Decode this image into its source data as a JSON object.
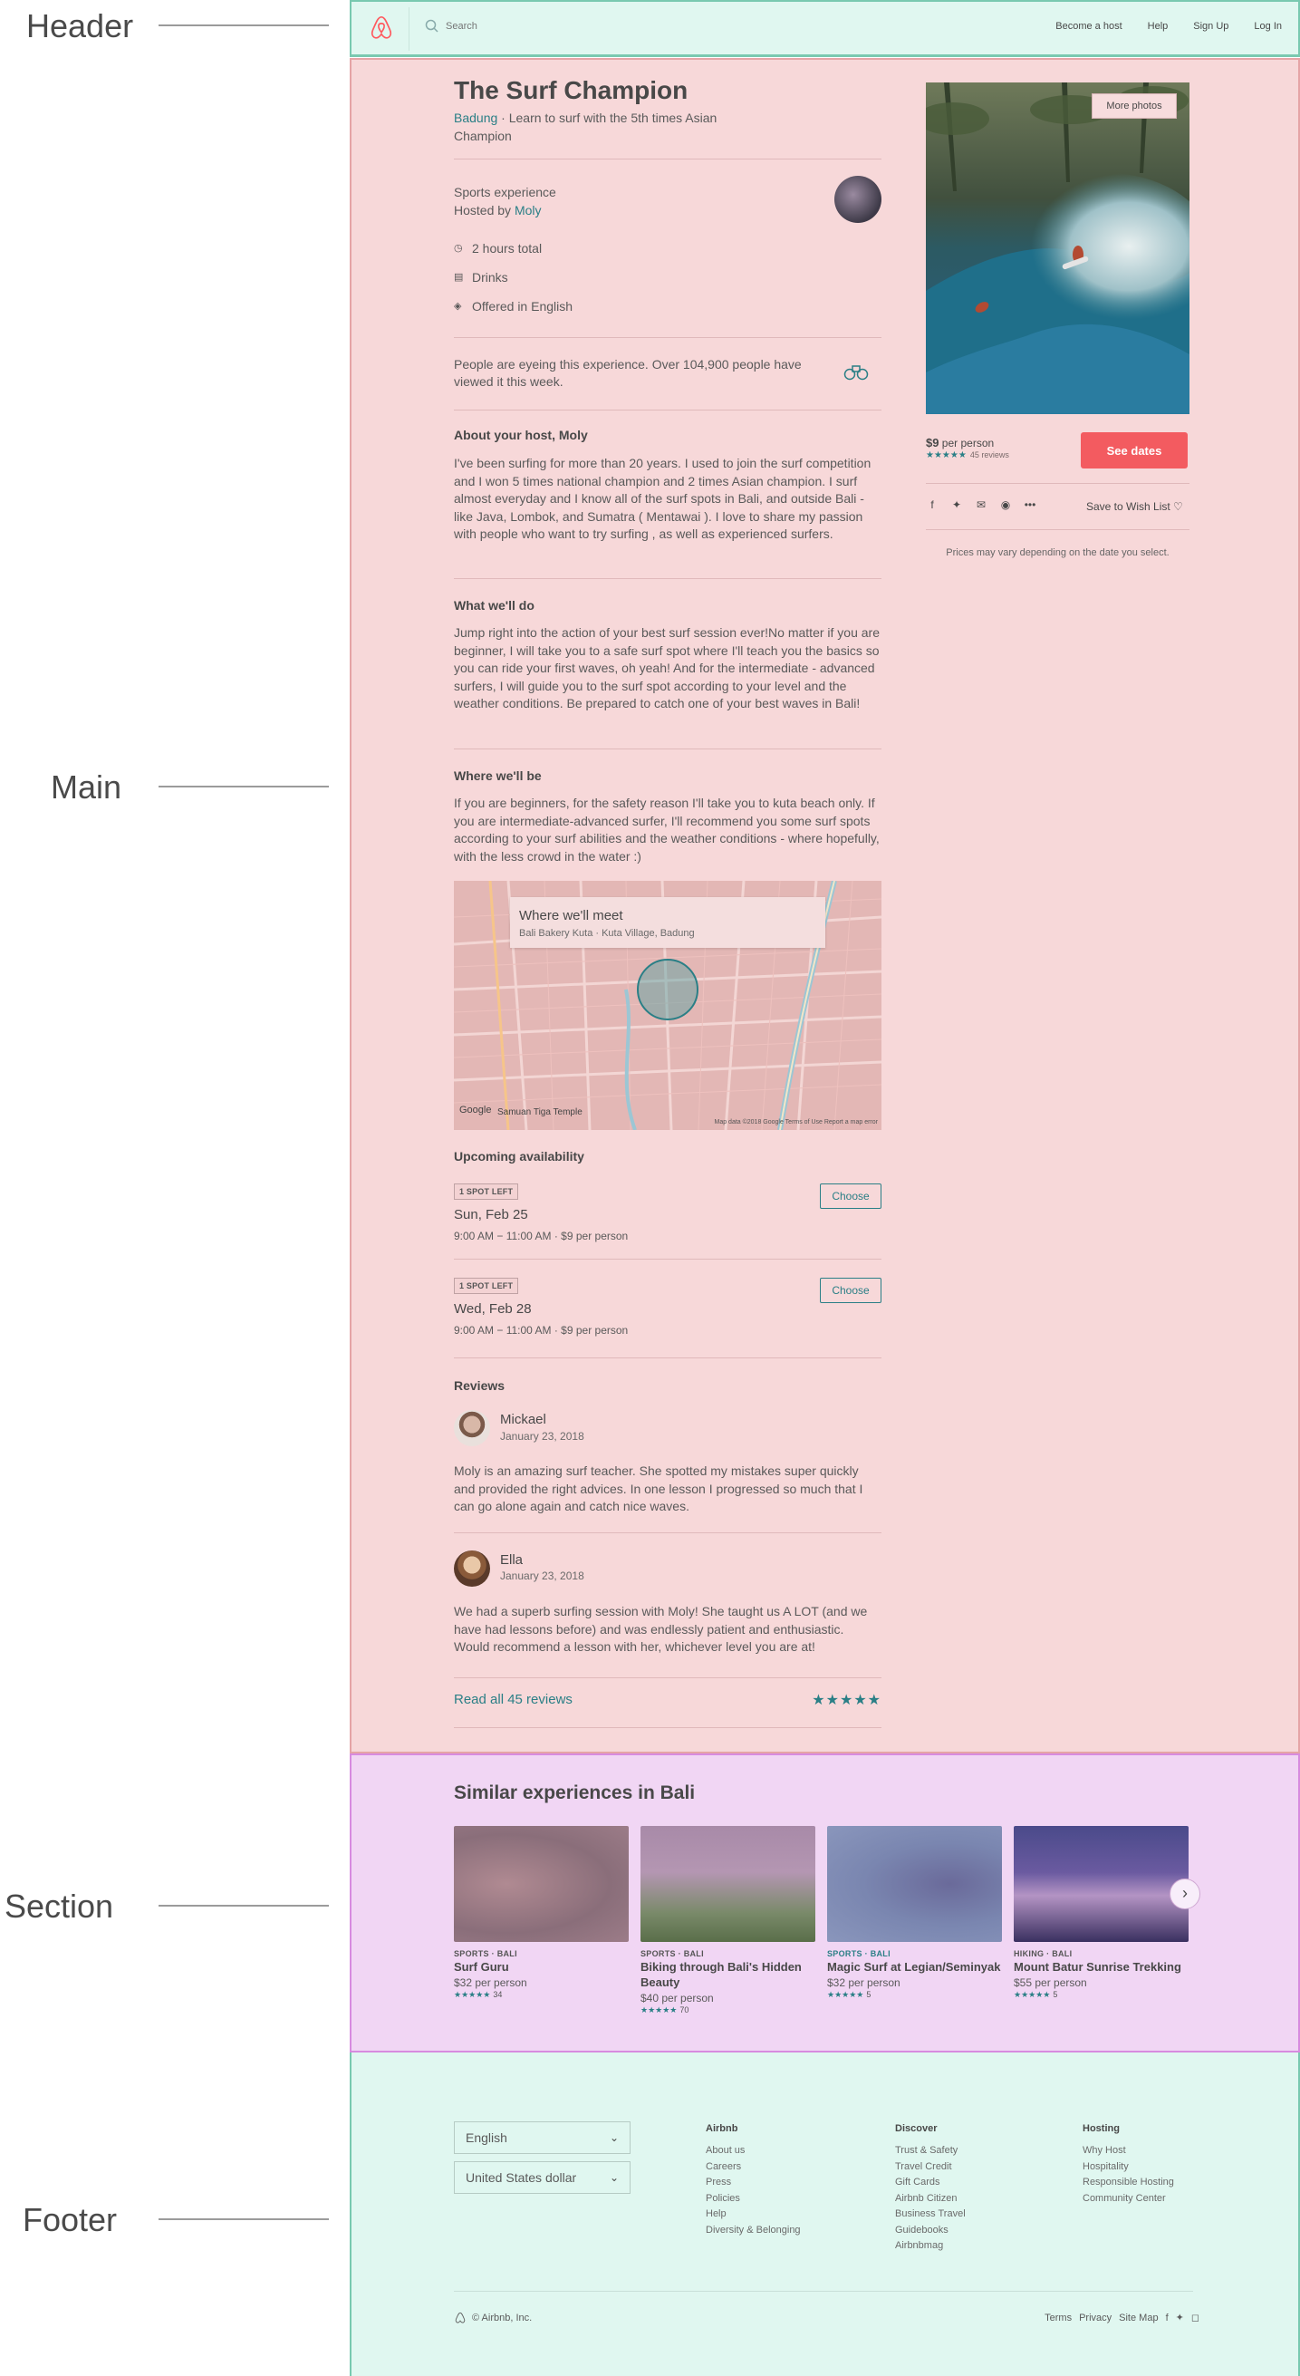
{
  "annotations": {
    "header": "Header",
    "main": "Main",
    "section": "Section",
    "footer": "Footer"
  },
  "header": {
    "search_placeholder": "Search",
    "nav": [
      "Become a host",
      "Help",
      "Sign Up",
      "Log In"
    ]
  },
  "experience": {
    "title": "The Surf Champion",
    "location": "Badung",
    "tagline": " · Learn to surf with the 5th times Asian Champion",
    "type": "Sports experience",
    "hosted_by_prefix": "Hosted by ",
    "host_name": "Moly",
    "features": [
      {
        "icon": "clock-icon",
        "glyph": "◷",
        "label": "2 hours total"
      },
      {
        "icon": "drinks-icon",
        "glyph": "▤",
        "label": "Drinks"
      },
      {
        "icon": "language-icon",
        "glyph": "◈",
        "label": "Offered in English"
      }
    ],
    "eyeing_text": "People are eyeing this experience. Over 104,900 people have viewed it this week.",
    "about_heading": "About your host, Moly",
    "about_text": "I've been surfing for more than 20 years. I used to join the surf competition and I won 5 times national champion and 2 times Asian champion. I surf almost everyday and I know all of the surf spots in Bali, and outside Bali - like Java, Lombok, and Sumatra ( Mentawai ). I love to share my passion with people who want to try surfing , as well as experienced surfers.",
    "what_heading": "What we'll do",
    "what_text": "Jump right into the action of your best surf session ever!No matter if you are beginner, I will take you to a safe surf spot where I'll teach you the basics so you can ride your first waves, oh yeah! And for the intermediate - advanced surfers, I will guide you to the surf spot according to your level and the weather conditions. Be prepared to catch one of your best waves in Bali!",
    "where_heading": "Where we'll be",
    "where_text": "If you are beginners, for the safety reason I'll take you to kuta beach only. If you are intermediate-advanced surfer, I'll recommend you some surf spots according to your surf abilities and the weather conditions - where hopefully, with the less crowd in the water :)"
  },
  "map": {
    "card_title": "Where we'll meet",
    "card_subtitle": "Bali Bakery Kuta · Kuta Village, Badung",
    "poi": "Samuan Tiga Temple",
    "google": "Google",
    "footer": "Map data ©2018 Google   Terms of Use   Report a map error"
  },
  "availability": {
    "heading": "Upcoming availability",
    "slots": [
      {
        "badge": "1 SPOT LEFT",
        "date": "Sun, Feb 25",
        "time": "9:00 AM − 11:00 AM · $9 per person",
        "button": "Choose"
      },
      {
        "badge": "1 SPOT LEFT",
        "date": "Wed, Feb 28",
        "time": "9:00 AM − 11:00 AM · $9 per person",
        "button": "Choose"
      }
    ]
  },
  "reviews": {
    "heading": "Reviews",
    "items": [
      {
        "name": "Mickael",
        "date": "January 23, 2018",
        "text": "Moly is an amazing surf teacher. She spotted my mistakes super quickly and provided the right advices. In one lesson I progressed so much that I can go alone again and catch nice waves."
      },
      {
        "name": "Ella",
        "date": "January 23, 2018",
        "text": "We had a superb surfing session with Moly! She taught us A LOT (and we have had lessons before) and was endlessly patient and enthusiastic. Would recommend a lesson with her, whichever level you are at!"
      }
    ],
    "read_all": "Read all 45 reviews",
    "stars": "★★★★★"
  },
  "booking": {
    "more_photos": "More photos",
    "price": "$9",
    "price_suffix": " per person",
    "stars": "★★★★★",
    "review_count": "45 reviews",
    "see_dates": "See dates",
    "save_wishlist": "Save to Wish List",
    "vary_note": "Prices may vary depending on the date you select."
  },
  "similar": {
    "heading": "Similar experiences in Bali",
    "cards": [
      {
        "category": "SPORTS · BALI",
        "name": "Surf Guru",
        "price": "$32 per person",
        "stars": "★★★★★",
        "count": "34"
      },
      {
        "category": "SPORTS · BALI",
        "name": "Biking through Bali's Hidden Beauty",
        "price": "$40 per person",
        "stars": "★★★★★",
        "count": "70"
      },
      {
        "category": "SPORTS · BALI",
        "name": "Magic Surf at Legian/Seminyak",
        "price": "$32 per person",
        "stars": "★★★★★",
        "count": "5"
      },
      {
        "category": "HIKING · BALI",
        "name": "Mount Batur Sunrise Trekking",
        "price": "$55 per person",
        "stars": "★★★★★",
        "count": "5"
      }
    ]
  },
  "footer": {
    "language": "English",
    "currency": "United States dollar",
    "columns": [
      {
        "heading": "Airbnb",
        "items": [
          "About us",
          "Careers",
          "Press",
          "Policies",
          "Help",
          "Diversity & Belonging"
        ]
      },
      {
        "heading": "Discover",
        "items": [
          "Trust & Safety",
          "Travel Credit",
          "Gift Cards",
          "Airbnb Citizen",
          "Business Travel",
          "Guidebooks",
          "Airbnbmag"
        ]
      },
      {
        "heading": "Hosting",
        "items": [
          "Why Host",
          "Hospitality",
          "Responsible Hosting",
          "Community Center"
        ]
      }
    ],
    "copyright": "© Airbnb, Inc.",
    "links": [
      "Terms",
      "Privacy",
      "Site Map"
    ]
  },
  "colors": {
    "brand": "#ff5a5f",
    "teal": "#2a7f86",
    "header_bg": "#e0f7f0",
    "main_bg": "#f7d8d9",
    "section_bg": "#f1d6f4"
  }
}
